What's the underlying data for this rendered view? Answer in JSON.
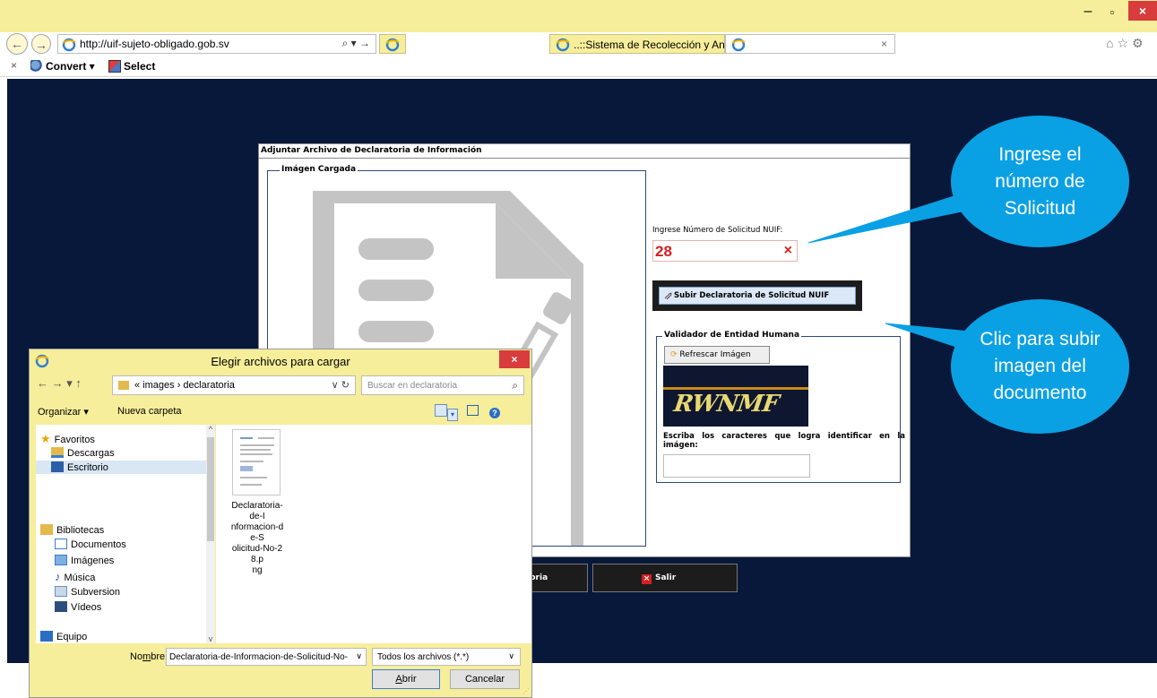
{
  "browser": {
    "window_controls": {
      "minimize": "–",
      "restore": "▫",
      "close": "×"
    },
    "url": "http://uif-sujeto-obligado.gob.sv",
    "address_controls": "⌕ ▾ →",
    "tabs": [
      {
        "label": ""
      },
      {
        "label": "..::Sistema de Recolección y An..."
      },
      {
        "label": "",
        "close": "×"
      }
    ],
    "toolbar_icons": "⌂☆⚙",
    "command_bar": {
      "close": "×",
      "convert": "Convert ▾",
      "select": "Select"
    }
  },
  "form": {
    "title": "Adjuntar Archivo de Declaratoria de Información",
    "image_legend": "Imágen Cargada",
    "nuif_label": "Ingrese Número de Solicitud NUIF:",
    "nuif_value": "28",
    "nuif_clear": "×",
    "upload_button": "Subir Declaratoria de Solicitud NUIF",
    "validator_legend": "Validador de Entidad Humana",
    "refresh_button": "Refrescar Imágen",
    "captcha_text": "RWNMF",
    "captcha_help": "Escriba los caracteres que logra identificar en la imágen:",
    "captcha_value": "",
    "save_button_visible": "atoria",
    "exit_button": "Salir"
  },
  "callouts": {
    "nuif": "Ingrese el número de Solicitud",
    "upload": "Clic para subir imagen del documento"
  },
  "dialog": {
    "title": "Elegir archivos para cargar",
    "close": "×",
    "nav": "← → ▾ ↑",
    "path": "« images › declaratoria",
    "path_controls": "∨ ↻",
    "search_placeholder": "Buscar en declaratoria",
    "search_icon": "⌕",
    "organize": "Organizar ▾",
    "new_folder": "Nueva carpeta",
    "help": "?",
    "tree": [
      {
        "label": "Favoritos"
      },
      {
        "label": "Descargas"
      },
      {
        "label": "Escritorio",
        "selected": true
      },
      {
        "label": "Bibliotecas"
      },
      {
        "label": "Documentos"
      },
      {
        "label": "Imágenes"
      },
      {
        "label": "Música"
      },
      {
        "label": "Subversion"
      },
      {
        "label": "Vídeos"
      },
      {
        "label": "Equipo"
      }
    ],
    "scroll": {
      "up": "^",
      "down": "v"
    },
    "file_name": "Declaratoria-de-Informacion-de-Solicitud-No-28.png",
    "file_label_lines": [
      "Declaratoria-de-I",
      "nformacion-de-S",
      "olicitud-No-28.p",
      "ng"
    ],
    "name_label_prefix": "No",
    "name_label_underlined": "m",
    "name_label_suffix": "bre:",
    "name_value": "Declaratoria-de-Informacion-de-Solicitud-No-",
    "filter_value": "Todos los archivos (*.*)",
    "open_button_underlined": "A",
    "open_button_rest": "brir",
    "cancel_button": "Cancelar"
  }
}
